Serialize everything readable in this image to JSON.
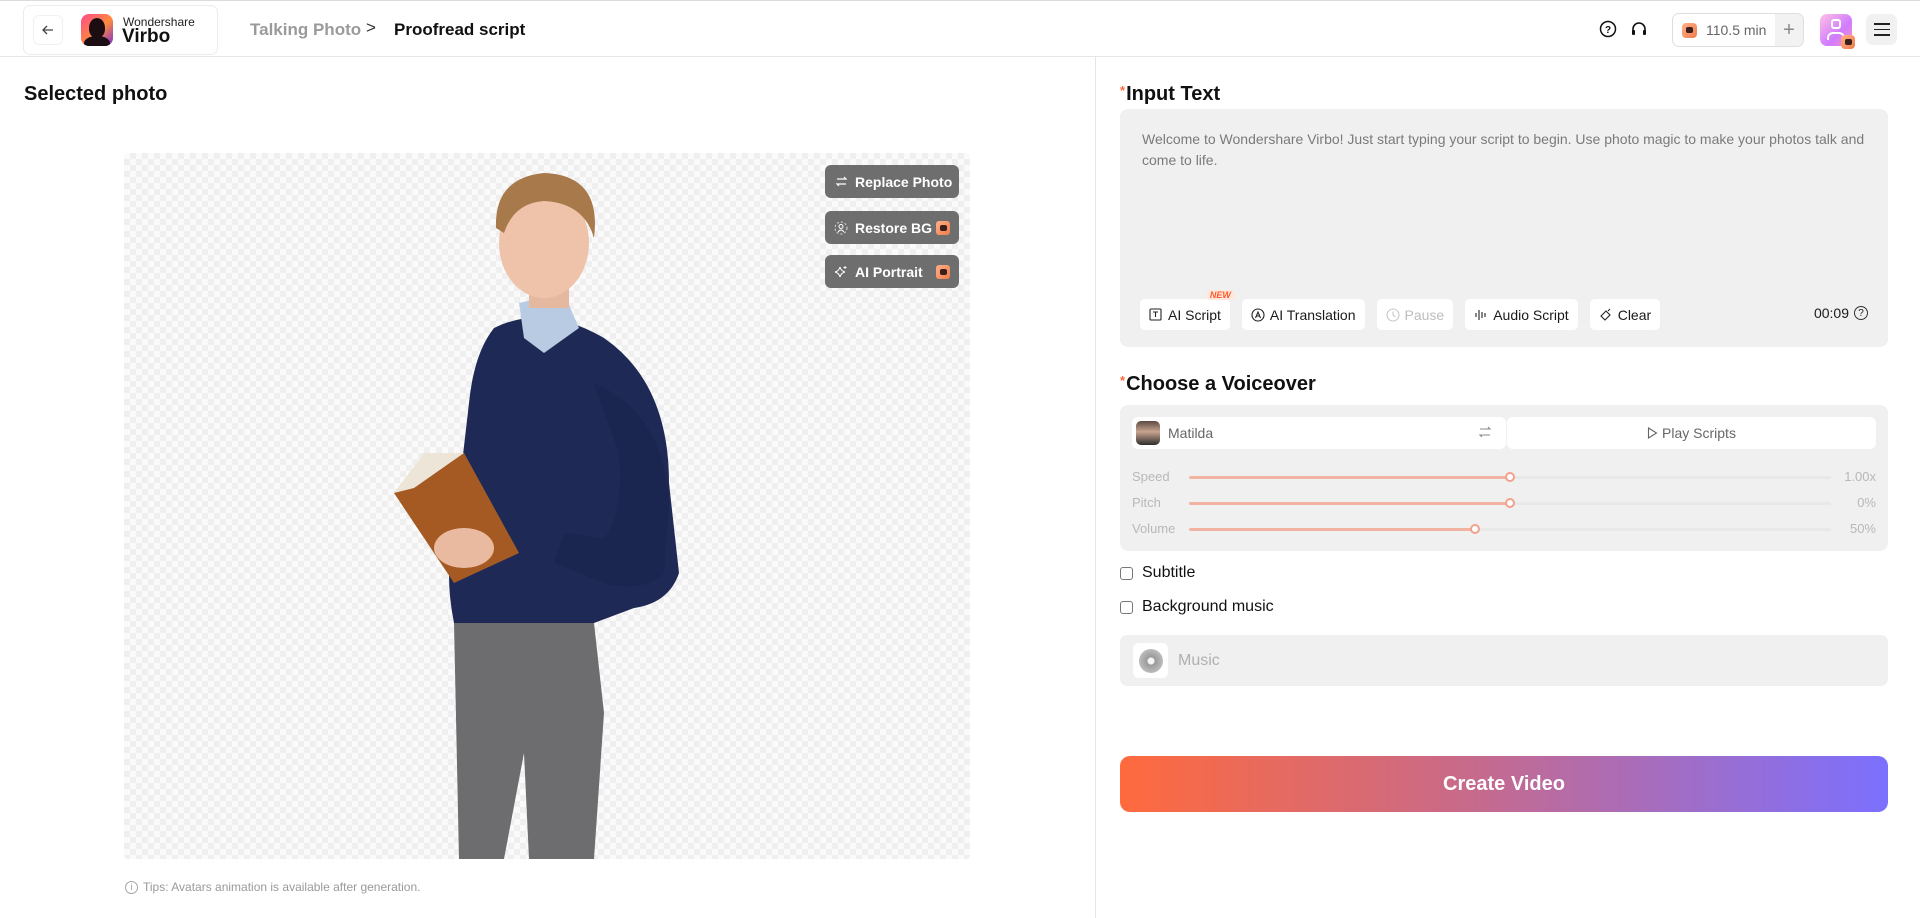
{
  "header": {
    "brand_small": "Wondershare",
    "brand_big": "Virbo",
    "breadcrumb": [
      {
        "label": "Talking Photo"
      },
      {
        "label": "Proofread script"
      }
    ],
    "breadcrumb_separator": ">",
    "credits": "110.5 min",
    "icons": {
      "back": "arrow-left-icon",
      "help": "question-circle-icon",
      "support": "headset-icon",
      "add_credits": "plus-icon",
      "menu": "hamburger-icon"
    }
  },
  "left": {
    "title": "Selected photo",
    "photo_actions": [
      {
        "label": "Replace Photo",
        "icon": "swap-icon",
        "pro": false
      },
      {
        "label": "Restore BG",
        "icon": "person-dashed-icon",
        "pro": true
      },
      {
        "label": "AI Portrait",
        "icon": "sparkle-icon",
        "pro": true
      }
    ],
    "tip": "Tips: Avatars animation is available after generation."
  },
  "input_text": {
    "required_mark": "*",
    "title": "Input Text",
    "value": "Welcome to Wondershare Virbo! Just start typing your script to begin. Use photo magic to make your photos talk and come to life.",
    "tools": [
      {
        "label": "AI Script",
        "badge": "NEW",
        "enabled": true
      },
      {
        "label": "AI Translation",
        "enabled": true
      },
      {
        "label": "Pause",
        "enabled": false
      },
      {
        "label": "Audio Script",
        "enabled": true
      },
      {
        "label": "Clear",
        "enabled": true
      }
    ],
    "duration": "00:09"
  },
  "voiceover": {
    "required_mark": "*",
    "title": "Choose a Voiceover",
    "voice_name": "Matilda",
    "play_label": "Play Scripts",
    "sliders": [
      {
        "label": "Speed",
        "value": "1.00x",
        "fraction": 0.5
      },
      {
        "label": "Pitch",
        "value": "0%",
        "fraction": 0.5
      },
      {
        "label": "Volume",
        "value": "50%",
        "fraction": 0.445
      }
    ]
  },
  "options": {
    "subtitle": {
      "label": "Subtitle",
      "checked": false
    },
    "background_music": {
      "label": "Background music",
      "checked": false
    },
    "music_placeholder": "Music"
  },
  "create_label": "Create Video",
  "colors": {
    "accent_orange": "#ff6a3d",
    "accent_purple": "#7c70ff",
    "slider_fill": "#f2b3a3"
  }
}
